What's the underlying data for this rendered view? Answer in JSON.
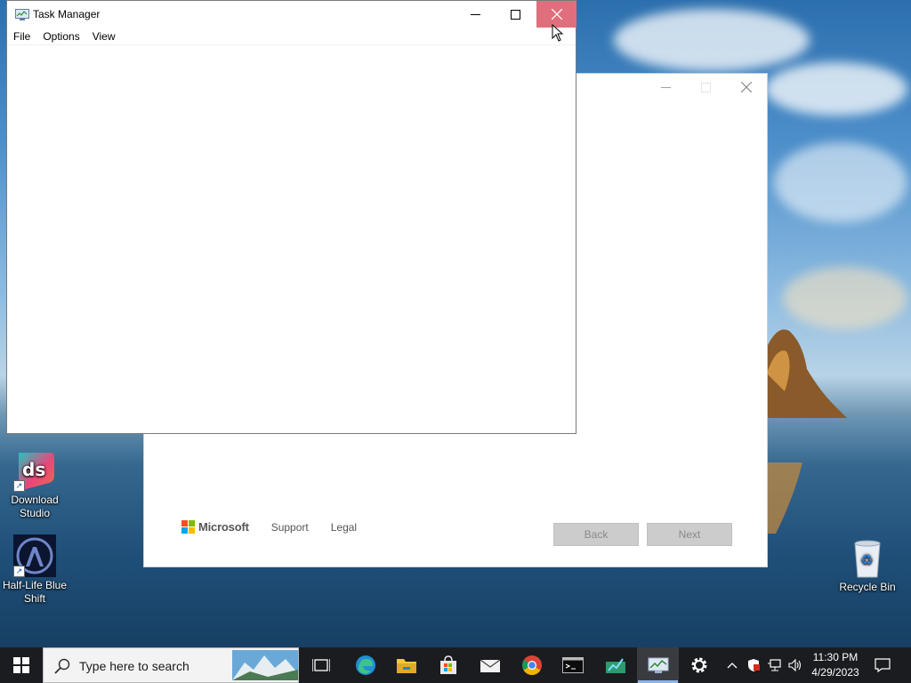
{
  "desktop": {
    "icons": [
      {
        "label": "Download Studio"
      },
      {
        "label": "Half-Life Blue Shift"
      },
      {
        "label": "Recycle Bin"
      }
    ]
  },
  "setup_window": {
    "brand": "Microsoft",
    "links": [
      "Support",
      "Legal"
    ],
    "back_label": "Back",
    "next_label": "Next"
  },
  "task_manager": {
    "title": "Task Manager",
    "menu": [
      "File",
      "Options",
      "View"
    ]
  },
  "taskbar": {
    "search_placeholder": "Type here to search",
    "time": "11:30 PM",
    "date": "4/29/2023",
    "pinned": [
      "task-view",
      "edge",
      "file-explorer",
      "microsoft-store",
      "mail",
      "chrome",
      "terminal",
      "app-with-chart",
      "task-manager",
      "settings"
    ]
  },
  "colors": {
    "close_hover": "#e06f7d",
    "taskbar_bg": "#1b1c20",
    "active_underline": "#8db4e8"
  }
}
